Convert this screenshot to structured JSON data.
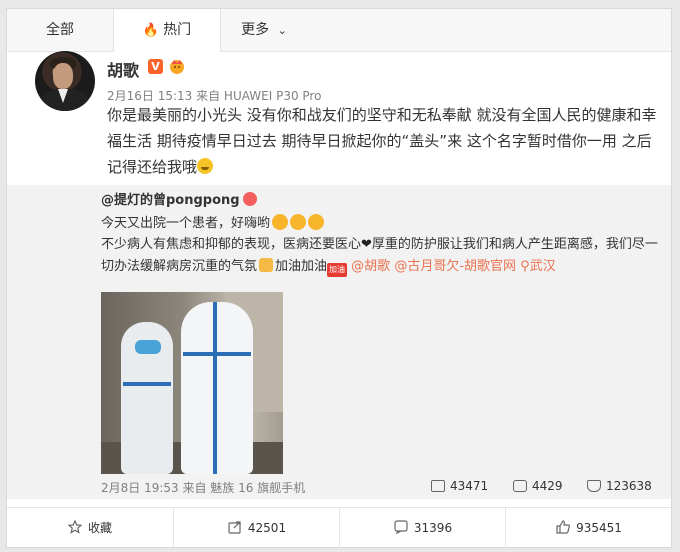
{
  "tabs": [
    {
      "label": "全部"
    },
    {
      "label": "热门",
      "icon": "fire-icon",
      "active": true
    },
    {
      "label": "更多",
      "icon": "chevron-down-icon"
    }
  ],
  "post": {
    "author": "胡歌",
    "verified_label": "V",
    "meta": "2月16日 15:13 来自 HUAWEI P30 Pro",
    "content": "你是最美丽的小光头 没有你和战友们的坚守和无私奉献 就没有全国人民的健康和幸福生活 期待疫情早日过去 期待早日掀起你的“盖头”来 这个名字暂时借你一用 之后记得还给我哦"
  },
  "repost": {
    "author": "@提灯的曾pongpong",
    "line1": "今天又出院一个患者，好嗨哟",
    "line2a": "不少病人有焦虑和抑郁的表现，医病还要医心",
    "line2b": "厚重的防护服让我们和病人产生距离感，我们尽一切办法缓解病房沉重的气氛",
    "line2c": "加油加油",
    "jiayou_label": "加油",
    "mention1": "@胡歌",
    "mention2": "@古月哥欠-胡歌官网",
    "location": "武汉",
    "meta": "2月8日 19:53 来自 魅族 16 旗舰手机",
    "stats": {
      "repost": "43471",
      "comment": "4429",
      "like": "123638"
    }
  },
  "actions": {
    "favorite": "收藏",
    "repost": "42501",
    "comment": "31396",
    "like": "935451"
  },
  "colors": {
    "accent": "#eb7350",
    "fire": "#f7632b",
    "repost_bg": "#f2f2f2"
  }
}
